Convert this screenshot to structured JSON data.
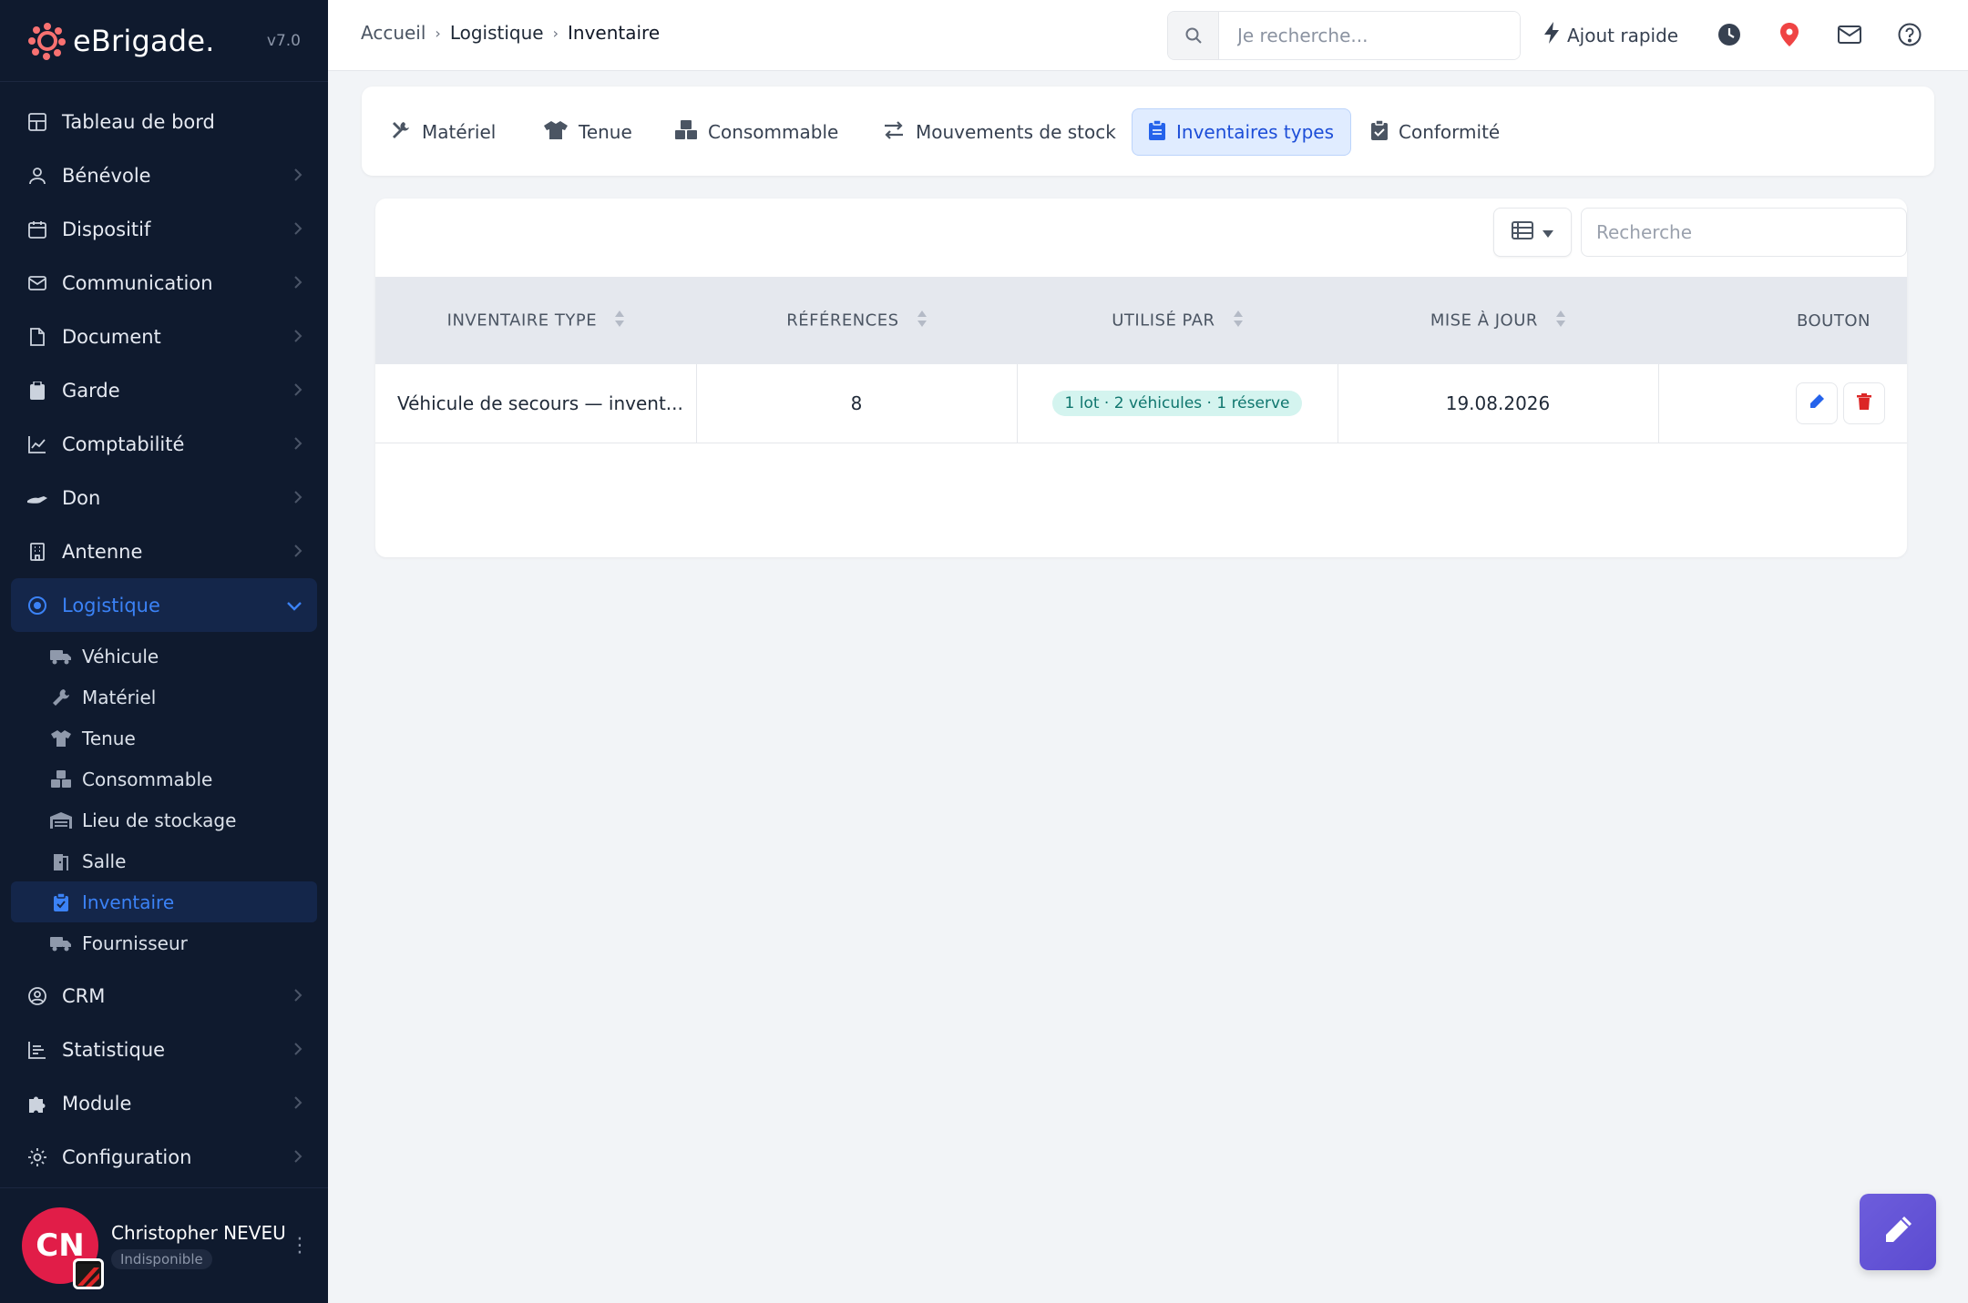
{
  "brand": {
    "name": "eBrigade.",
    "version": "v7.0"
  },
  "sidebar": {
    "items": [
      {
        "label": "Tableau de bord",
        "icon": "dashboard-icon"
      },
      {
        "label": "Bénévole",
        "icon": "user-icon"
      },
      {
        "label": "Dispositif",
        "icon": "calendar-icon"
      },
      {
        "label": "Communication",
        "icon": "mail-icon"
      },
      {
        "label": "Document",
        "icon": "document-icon"
      },
      {
        "label": "Garde",
        "icon": "clipboard-icon"
      },
      {
        "label": "Comptabilité",
        "icon": "chart-line-icon"
      },
      {
        "label": "Don",
        "icon": "hand-icon"
      },
      {
        "label": "Antenne",
        "icon": "building-icon"
      },
      {
        "label": "Logistique",
        "icon": "target-icon"
      }
    ],
    "sub_items": [
      {
        "label": "Véhicule",
        "icon": "truck-icon"
      },
      {
        "label": "Matériel",
        "icon": "wrench-icon"
      },
      {
        "label": "Tenue",
        "icon": "shirt-icon"
      },
      {
        "label": "Consommable",
        "icon": "boxes-icon"
      },
      {
        "label": "Lieu de stockage",
        "icon": "warehouse-icon"
      },
      {
        "label": "Salle",
        "icon": "door-icon"
      },
      {
        "label": "Inventaire",
        "icon": "clipboard-check-icon"
      },
      {
        "label": "Fournisseur",
        "icon": "truck-icon"
      }
    ],
    "bottom_items": [
      {
        "label": "CRM",
        "icon": "user-circle-icon"
      },
      {
        "label": "Statistique",
        "icon": "bar-chart-icon"
      },
      {
        "label": "Module",
        "icon": "puzzle-icon"
      },
      {
        "label": "Configuration",
        "icon": "gear-icon"
      }
    ]
  },
  "user": {
    "initials": "CN",
    "name": "Christopher NEVEU",
    "status": "Indisponible"
  },
  "breadcrumb": {
    "home": "Accueil",
    "section": "Logistique",
    "page": "Inventaire"
  },
  "search": {
    "placeholder": "Je recherche..."
  },
  "quick_add": {
    "label": "Ajout rapide"
  },
  "tabs": [
    {
      "label": "Matériel"
    },
    {
      "label": "Tenue"
    },
    {
      "label": "Consommable"
    },
    {
      "label": "Mouvements de stock"
    },
    {
      "label": "Inventaires types"
    },
    {
      "label": "Conformité"
    }
  ],
  "table": {
    "search_placeholder": "Recherche",
    "headers": [
      "INVENTAIRE TYPE",
      "RÉFÉRENCES",
      "UTILISÉ PAR",
      "MISE À JOUR",
      "BOUTON"
    ],
    "rows": [
      {
        "name": "Véhicule de secours — invent...",
        "refs": "8",
        "used_by": "1 lot · 2 véhicules · 1 réserve",
        "updated": "19.08.2026"
      }
    ]
  },
  "colors": {
    "sidebar_bg": "#0f1a2e",
    "accent": "#3b82f6",
    "danger": "#e11d48",
    "badge_bg": "#d4f4ef"
  }
}
